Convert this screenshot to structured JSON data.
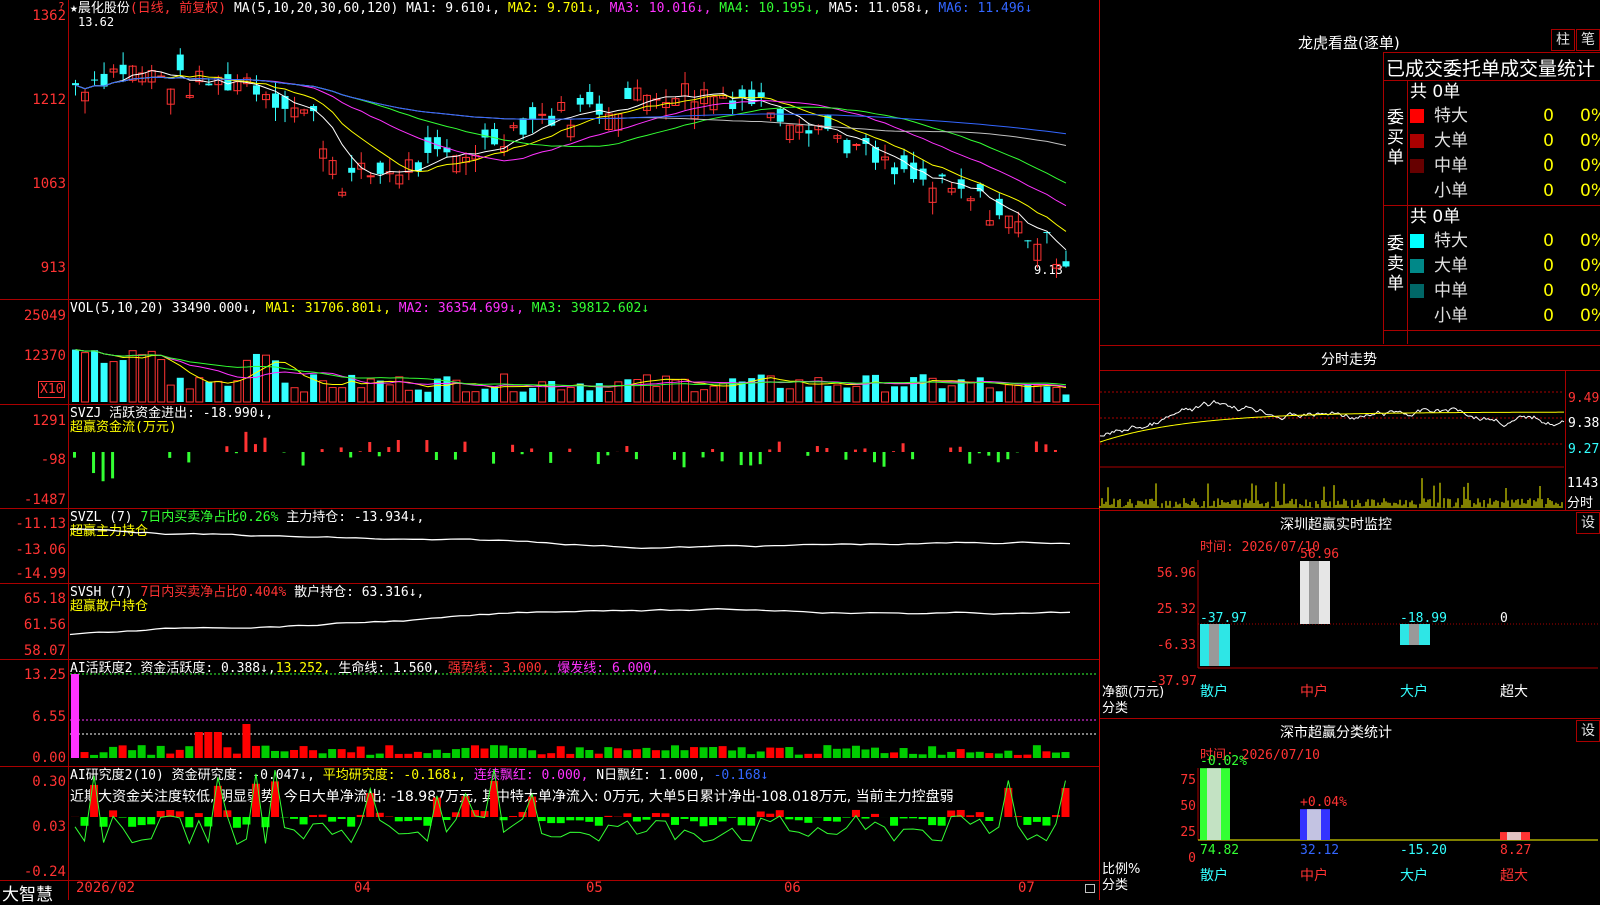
{
  "app_title": "大智慧",
  "main_chart": {
    "stock_name": "★晨化股份",
    "period": "(日线, 前复权)",
    "ma_label": "MA(5,10,20,30,60,120)",
    "ma1": "MA1: 9.610↓,",
    "ma2": "MA2: 9.701↓,",
    "ma3": "MA3: 10.016↓,",
    "ma4": "MA4: 10.195↓,",
    "ma5": "MA5: 11.058↓,",
    "ma6": "MA6: 11.496↓",
    "y_ticks": [
      "1362",
      "1212",
      "1063",
      "913"
    ],
    "high_label": "13.62",
    "low_label": "9.13"
  },
  "vol_panel": {
    "label": "VOL(5,10,20)",
    "value": "33490.000↓,",
    "ma1": "MA1: 31706.801↓,",
    "ma2": "MA2: 36354.699↓,",
    "ma3": "MA3: 39812.602↓",
    "y_ticks": [
      "25049",
      "12370"
    ],
    "unit": "X10"
  },
  "svzj_panel": {
    "label": "SVZJ",
    "desc": "活跃资金进出: -18.990↓,",
    "sub": "超赢资金流(万元)",
    "y_ticks": [
      "1291",
      "-98",
      "-1487"
    ]
  },
  "svzl_panel": {
    "label": "SVZL (7)",
    "desc": "7日内买卖净占比0.26%",
    "hold": "主力持仓: -13.934↓,",
    "sub": "超赢主力持仓",
    "y_ticks": [
      "-11.13",
      "-13.06",
      "-14.99"
    ]
  },
  "svsh_panel": {
    "label": "SVSH (7)",
    "desc": "7日内买卖净占比0.404%",
    "hold": "散户持仓: 63.316↓,",
    "sub": "超赢散户持仓",
    "y_ticks": [
      "65.18",
      "61.56",
      "58.07"
    ]
  },
  "ai2_panel": {
    "label": "AI活跃度2",
    "desc": "资金活跃度: 0.388↓,",
    "v2": "13.252,",
    "life": "生命线: 1.560,",
    "strong": "强势线: 3.000,",
    "burst": "爆发线: 6.000,",
    "y_ticks": [
      "13.25",
      "6.55",
      "0.00"
    ]
  },
  "ai_research_panel": {
    "label": "AI研究度2(10)",
    "desc": "资金研究度: -0.047↓,",
    "avg": "平均研究度: -0.168↓,",
    "cont": "连续飘红: 0.000,",
    "nday": "N日飘红: 1.000,",
    "last": "-0.168↓",
    "comment": "近期大资金关注度较低, 明显弱势, 今日大单净流出: -18.987万元, 其中特大单净流入: 0万元, 大单5日累计净出-108.018万元, 当前主力控盘弱",
    "y_ticks": [
      "0.30",
      "0.03",
      "-0.24"
    ]
  },
  "x_axis": [
    "2026/02",
    "04",
    "05",
    "06",
    "07"
  ],
  "right_panel": {
    "lhb_title": "龙虎看盘(逐单)",
    "btn_zhu": "柱",
    "btn_bi": "笔",
    "stats_title": "已成交委托单成交量统计",
    "buy_label": "委买单",
    "sell_label": "委卖单",
    "buy_total": "共 0单",
    "sell_total": "共 0单",
    "buy_rows": [
      {
        "name": "特大",
        "count": "0",
        "pct": "0%",
        "color": "#ff0000"
      },
      {
        "name": "大单",
        "count": "0",
        "pct": "0%",
        "color": "#aa0000"
      },
      {
        "name": "中单",
        "count": "0",
        "pct": "0%",
        "color": "#660000"
      },
      {
        "name": "小单",
        "count": "0",
        "pct": "0%",
        "color": ""
      }
    ],
    "sell_rows": [
      {
        "name": "特大",
        "count": "0",
        "pct": "0%",
        "color": "#00ffff"
      },
      {
        "name": "大单",
        "count": "0",
        "pct": "0%",
        "color": "#008888"
      },
      {
        "name": "中单",
        "count": "0",
        "pct": "0%",
        "color": "#006666"
      },
      {
        "name": "小单",
        "count": "0",
        "pct": "0%",
        "color": ""
      }
    ],
    "intraday_title": "分时走势",
    "intraday_y": [
      "9.49",
      "9.38",
      "9.27"
    ],
    "intraday_vol": "1143",
    "intraday_vol_label": "分时",
    "sz_monitor_title": "深圳超赢实时监控",
    "sz_btn": "设",
    "sz_time": "时间: 2026/07/10",
    "sz_y": [
      "56.96",
      "25.32",
      "-6.33",
      "-37.97"
    ],
    "sz_bars": [
      {
        "cat": "散户",
        "value": -37.97,
        "label": "-37.97"
      },
      {
        "cat": "中户",
        "value": 56.96,
        "label": "56.96"
      },
      {
        "cat": "大户",
        "value": -18.99,
        "label": "-18.99"
      },
      {
        "cat": "超大",
        "value": 0,
        "label": "0"
      }
    ],
    "sz_axis_label1": "净额(万元)",
    "sz_axis_label2": "分类",
    "class_title": "深市超赢分类统计",
    "class_btn": "设",
    "class_time": "时间: 2026/07/10",
    "class_y": [
      "75",
      "50",
      "25",
      "0"
    ],
    "class_bars": [
      {
        "cat": "散户",
        "value": 74.82,
        "top": "-0.02%",
        "bottom": "74.82"
      },
      {
        "cat": "中户",
        "value": 32.12,
        "top": "+0.04%",
        "bottom": "32.12"
      },
      {
        "cat": "大户",
        "value": -15.2,
        "top": "",
        "bottom": "-15.20"
      },
      {
        "cat": "超大",
        "value": 8.27,
        "top": "",
        "bottom": "8.27"
      }
    ],
    "class_axis_label1": "比例%",
    "class_axis_label2": "分类"
  }
}
